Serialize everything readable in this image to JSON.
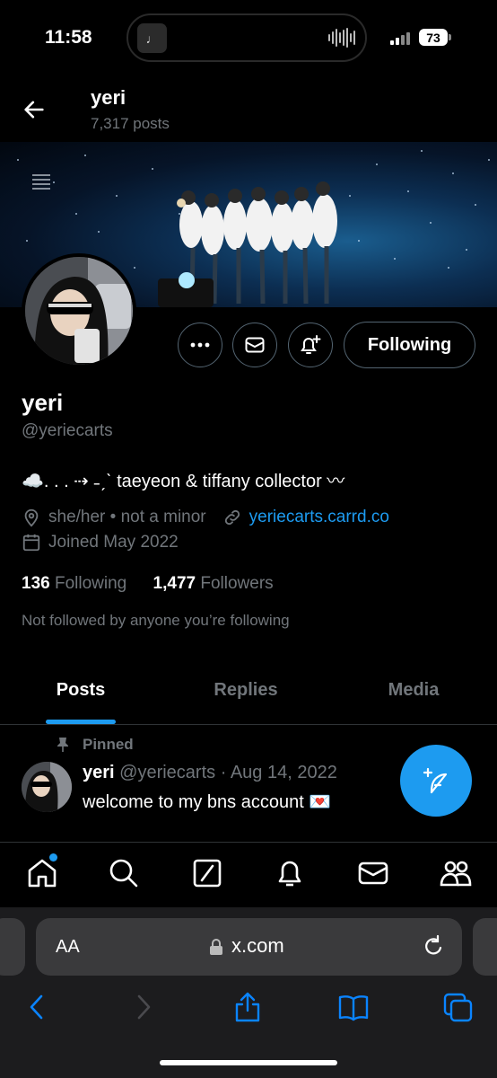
{
  "status_bar": {
    "time": "11:58",
    "battery": "73",
    "media_icon": "music-note-icon"
  },
  "header": {
    "name": "yeri",
    "posts_count": "7,317 posts"
  },
  "profile": {
    "name": "yeri",
    "handle": "@yeriecarts",
    "bio": "☁️. . . ⇢ ˗ˏˋ taeyeon & tiffany collector 〰",
    "pronouns": "she/her • not a minor",
    "website": "yeriecarts.carrd.co",
    "joined": "Joined May 2022",
    "following_count": "136",
    "following_label": "Following",
    "followers_count": "1,477",
    "followers_label": "Followers",
    "not_followed_text": "Not followed by anyone you’re following",
    "following_button": "Following"
  },
  "tabs": [
    {
      "label": "Posts",
      "active": true
    },
    {
      "label": "Replies",
      "active": false
    },
    {
      "label": "Media",
      "active": false
    }
  ],
  "post": {
    "pinned_label": "Pinned",
    "author": "yeri",
    "handle_date": "@yeriecarts · Aug 14, 2022",
    "text": "welcome to my bns account 💌"
  },
  "bottom_nav": [
    "home-icon",
    "search-icon",
    "grok-icon",
    "notifications-icon",
    "messages-icon",
    "communities-icon"
  ],
  "browser": {
    "text_size_label": "AA",
    "url": "x.com"
  },
  "colors": {
    "accent": "#1d9bf0",
    "background": "#000000",
    "muted": "#71767b"
  }
}
